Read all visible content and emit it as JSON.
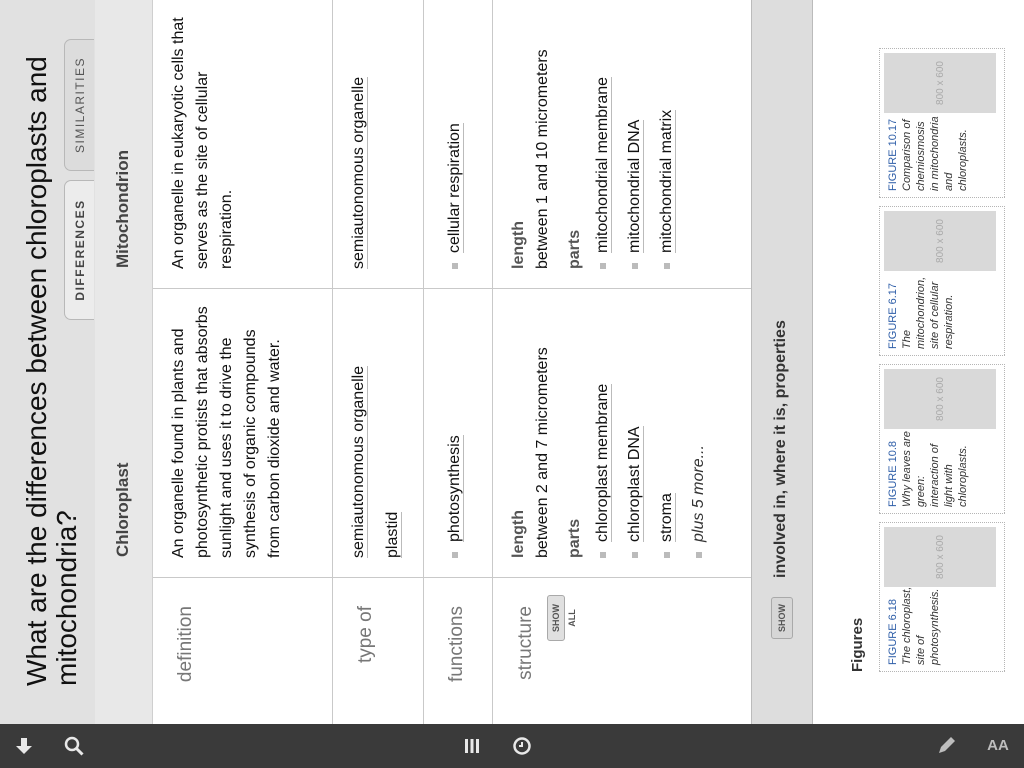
{
  "page": {
    "title": "What are the differences between chloroplasts and mitochondria?",
    "tabs": [
      {
        "label": "DIFFERENCES",
        "active": true
      },
      {
        "label": "SIMILARITIES",
        "active": false
      }
    ]
  },
  "table": {
    "columns": [
      "Chloroplast",
      "Mitochondrion"
    ],
    "rows": {
      "definition": {
        "label": "definition",
        "chloroplast": "An organelle found in plants and photosynthetic protists that absorbs sunlight and uses it to drive the synthesis of organic compounds from carbon dioxide and water.",
        "mitochondrion": "An organelle in eukaryotic cells that serves as the site of cellular respiration."
      },
      "type_of": {
        "label": "type of",
        "chloroplast": [
          "semiautonomous organelle",
          "plastid"
        ],
        "mitochondrion": [
          "semiautonomous organelle"
        ]
      },
      "functions": {
        "label": "functions",
        "chloroplast": [
          "photosynthesis"
        ],
        "mitochondrion": [
          "cellular respiration"
        ]
      },
      "structure": {
        "label": "structure",
        "show_all": "SHOW ALL",
        "length_label": "length",
        "parts_label": "parts",
        "chloroplast_length": "between 2 and 7 micrometers",
        "mitochondrion_length": "between 1 and 10 micrometers",
        "chloroplast_parts": [
          "chloroplast membrane",
          "chloroplast DNA",
          "stroma"
        ],
        "chloroplast_more": "plus 5 more...",
        "mitochondrion_parts": [
          "mitochondrial membrane",
          "mitochondrial DNA",
          "mitochondrial matrix"
        ]
      }
    }
  },
  "relations": {
    "show_label": "SHOW",
    "text": "involved in, where it is, properties"
  },
  "figures": {
    "title": "Figures",
    "items": [
      {
        "fig": "FIGURE 6.18",
        "caption": "The chloroplast, site of photosynthesis.",
        "thumb": "800 x 600"
      },
      {
        "fig": "FIGURE 10.8",
        "caption": "Why leaves are green: interaction of light with chloroplasts.",
        "thumb": "800 x 600"
      },
      {
        "fig": "FIGURE 6.17",
        "caption": "The mitochondrion, site of cellular respiration.",
        "thumb": "800 x 600"
      },
      {
        "fig": "FIGURE 10.17",
        "caption": "Comparison of chemiosmosis in mitochondria and chloroplasts.",
        "thumb": "800 x 600"
      }
    ]
  },
  "toolbar": {
    "icons": [
      "download-icon",
      "search-icon",
      "list-icon",
      "clock-icon",
      "pencil-icon",
      "font-size-icon"
    ],
    "font_size_label": "AA"
  }
}
